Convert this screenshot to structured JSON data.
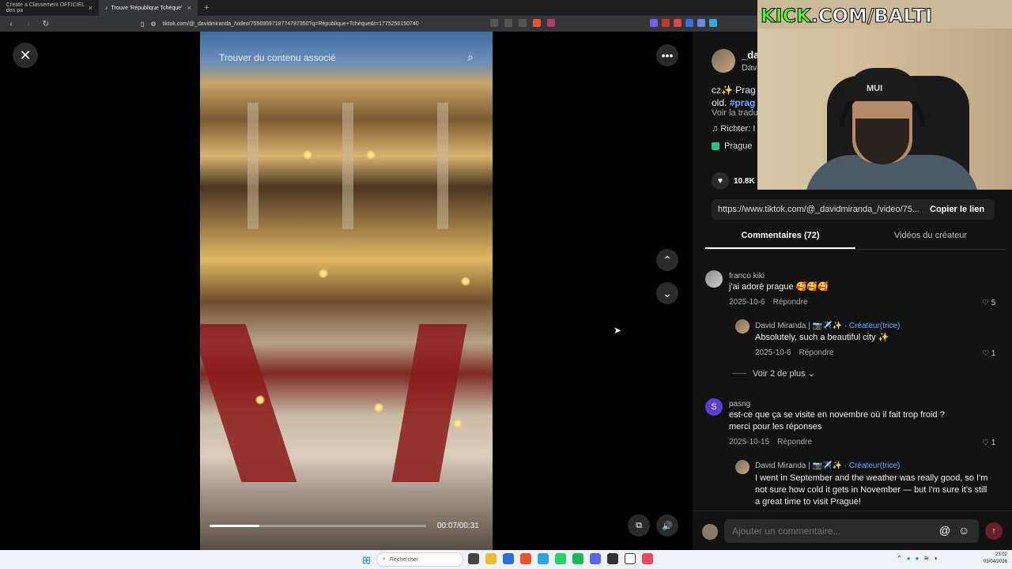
{
  "browser": {
    "tabs": [
      {
        "label": "Create a Classement OFFICIEL des pa",
        "active": false
      },
      {
        "label": "Trouve 'République Tchèque'",
        "active": true
      }
    ],
    "url": "tiktok.com/@_davidmiranda_/video/7556959718774787350?q=République+Tchèque&t=1775250150740"
  },
  "video": {
    "search_overlay": "Trouver du contenu associé",
    "time": "00:07/00:31",
    "progress_fraction": 0.23
  },
  "panel": {
    "author_name": "_da",
    "author_sub": "Dav",
    "desc_prefix": "cz✨ Prag",
    "desc_line2": "old.",
    "desc_tag": "#prag",
    "translate": "Voir la tradu",
    "music": "♫ Richter: I",
    "location": "Prague",
    "likes": "10.8K",
    "link": "https://www.tiktok.com/@_davidmiranda_/video/75...",
    "copy_label": "Copier le lien",
    "tab_comments": "Commentaires (72)",
    "tab_creator": "Vidéos du créateur",
    "comments": [
      {
        "user": "franco kiki",
        "text": "j'ai adoré prague 🥰🥰🥰",
        "date": "2025-10-6",
        "reply": "Répondre",
        "likes": "♡ 5"
      },
      {
        "user": "David Miranda | 📷✈️✨",
        "badge": "· Créateur(trice)",
        "text": "Absolutely, such a beautiful city ✨",
        "date": "2025-10-6",
        "reply": "Répondre",
        "likes": "♡ 1"
      },
      {
        "user": "pasng",
        "text": "est-ce que ça se visite en novembre où il fait trop froid ? merci pour les réponses",
        "date": "2025-10-15",
        "reply": "Répondre",
        "likes": "♡ 1"
      },
      {
        "user": "David Miranda | 📷✈️✨",
        "badge": "· Créateur(trice)",
        "text": "I went in September and the weather was really good, so I'm not sure how cold it gets in November — but I'm sure it's still a great time to visit Prague!",
        "date": "",
        "reply": "",
        "likes": ""
      }
    ],
    "more_replies": "Voir 2 de plus ⌄",
    "comment_placeholder": "Ajouter un commentaire..."
  },
  "stream": {
    "kick_brand": "KICK",
    "kick_rest": ".COM/BALTI",
    "cap_text": "MUI"
  },
  "taskbar": {
    "search": "Rechercher",
    "time": "23:02",
    "date": "03/04/2026"
  },
  "icons": {
    "close": "close-icon",
    "more": "more-icon",
    "up": "chevron-up-icon",
    "down": "chevron-down-icon",
    "volume": "volume-icon",
    "pip": "pip-icon"
  }
}
